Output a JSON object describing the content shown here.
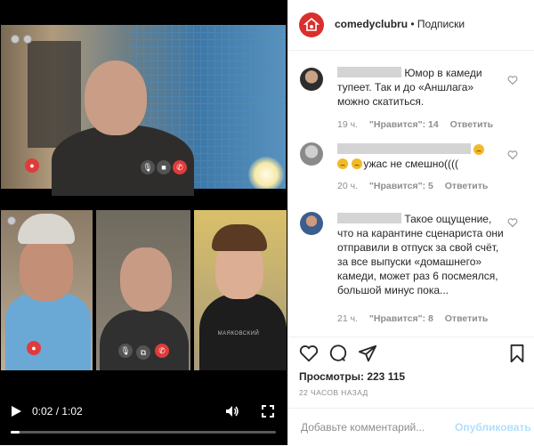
{
  "video": {
    "current_time": "0:02",
    "duration": "1:02",
    "time_label": "0:02 / 1:02",
    "progress": 0.032,
    "shirt_text": "МАЯКОВСКИЙ"
  },
  "post": {
    "username": "comedyclubru",
    "separator": "•",
    "follow_label": "Подписки",
    "brand_color": "#d9302b"
  },
  "comments": [
    {
      "text": "Юмор в камеди тупеет. Так и до «Аншлага» можно скатиться.",
      "age": "19 ч.",
      "likes": "\"Нравится\": 14",
      "reply": "Ответить"
    },
    {
      "text": "ужас не смешно((((",
      "age": "20 ч.",
      "likes": "\"Нравится\": 5",
      "reply": "Ответить"
    },
    {
      "text": "Такое ощущение, что на карантине сценариста они отправили в отпуск за свой счёт, за все выпуски «домашнего» камеди, может раз 6 посмеялся, большой минус пока...",
      "age": "21 ч.",
      "likes": "\"Нравится\": 8",
      "reply": "Ответить"
    }
  ],
  "stats": {
    "views": "Просмотры: 223 115",
    "posted_ago": "22 ЧАСОВ НАЗАД"
  },
  "add_comment": {
    "placeholder": "Добавьте комментарий...",
    "publish_label": "Опубликовать"
  },
  "icons": [
    "play-icon",
    "volume-icon",
    "fullscreen-icon",
    "heart-icon",
    "comment-icon",
    "share-icon",
    "bookmark-icon",
    "logo-icon"
  ]
}
